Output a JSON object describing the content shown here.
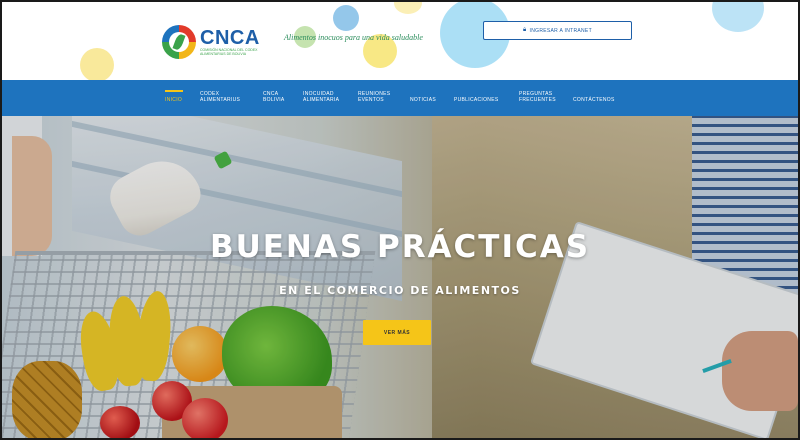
{
  "header": {
    "logo": {
      "name": "CNCA",
      "subtitle": "COMISIÓN NACIONAL DEL CODEX ALIMENTARIUS DE BOLIVIA"
    },
    "tagline": "Alimentos inocuos para una vida saludable",
    "login_button": {
      "icon": "lock-icon",
      "label": "INGRESAR A INTRANET"
    }
  },
  "nav": {
    "items": [
      {
        "label": "INICIO",
        "active": true
      },
      {
        "label": "CODEX ALIMENTARIUS",
        "active": false
      },
      {
        "label": "CNCA BOLIVIA",
        "active": false
      },
      {
        "label": "INOCUIDAD ALIMENTARIA",
        "active": false
      },
      {
        "label": "REUNIONES EVENTOS",
        "active": false
      },
      {
        "label": "NOTICIAS",
        "active": false
      },
      {
        "label": "PUBLICACIONES",
        "active": false
      },
      {
        "label": "PREGUNTAS FRECUENTES",
        "active": false
      },
      {
        "label": "CONTÁCTENOS",
        "active": false
      }
    ]
  },
  "hero": {
    "title": "BUENAS PRÁCTICAS",
    "subtitle": "EN EL COMERCIO DE ALIMENTOS",
    "cta_label": "VER MÁS"
  },
  "colors": {
    "nav_blue": "#1e73be",
    "accent_yellow": "#f5c518",
    "logo_blue": "#1e5fa8",
    "tagline_green": "#2b8d5c"
  }
}
